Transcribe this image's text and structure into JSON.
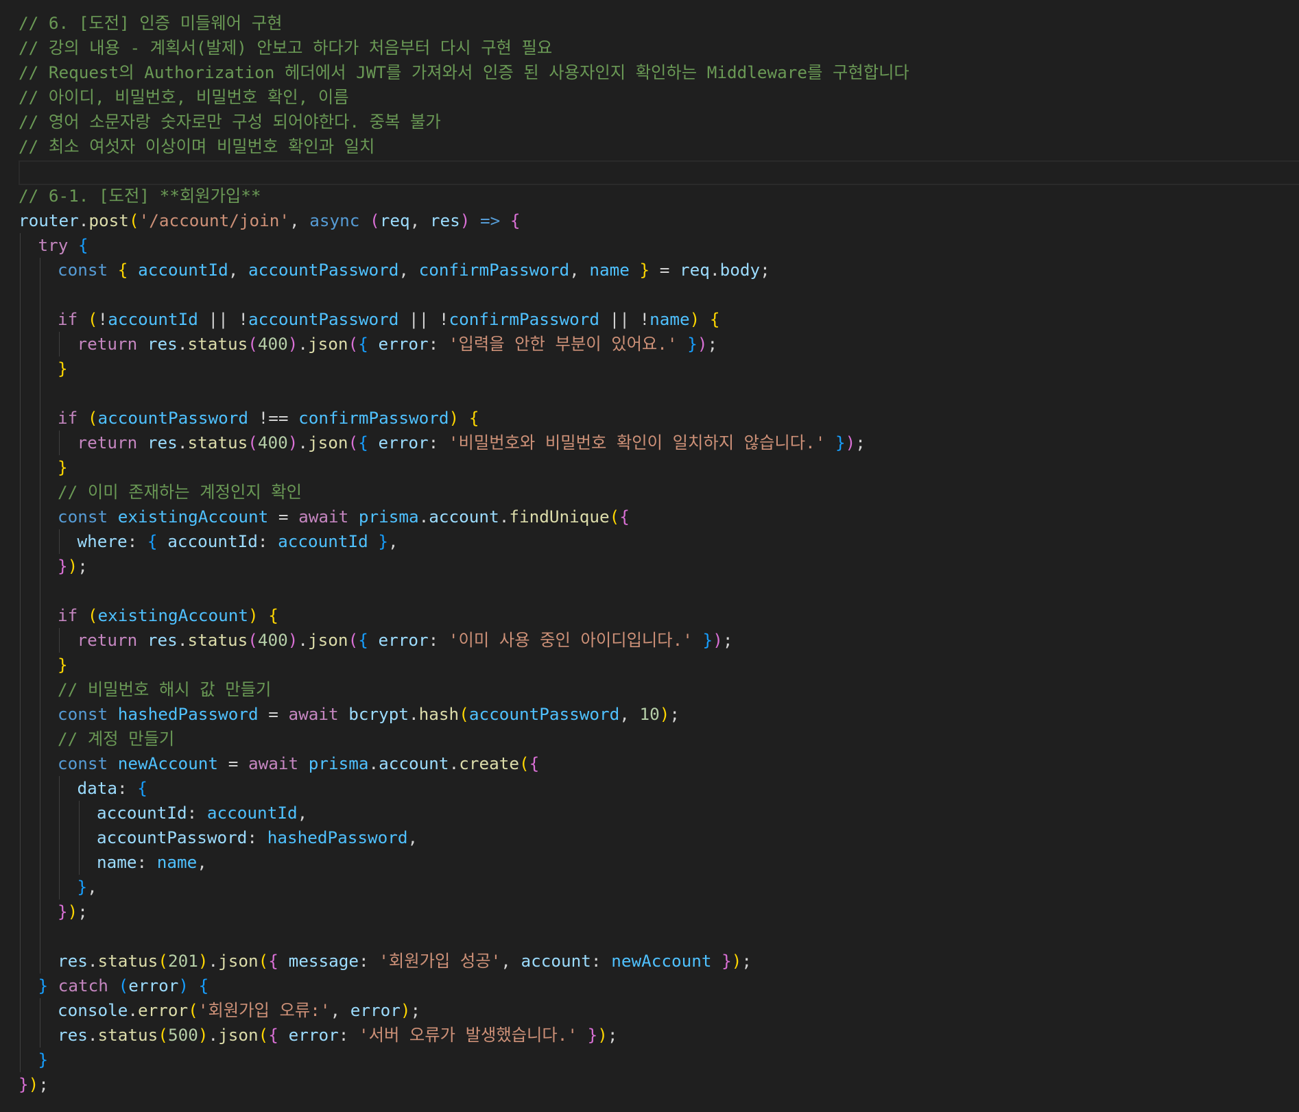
{
  "theme": {
    "background": "#1f1f1f",
    "colors": {
      "cmt": "#6a9955",
      "key": "#c586c0",
      "dec": "#569cd6",
      "var": "#4fc1ff",
      "prop": "#9cdcfe",
      "fn": "#dcdcaa",
      "str": "#ce9178",
      "num": "#b5cea8",
      "p1": "#ffd700",
      "p2": "#da70d6",
      "p3": "#179fff",
      "pl": "#d4d4d4"
    }
  },
  "code": [
    {
      "indent": 0,
      "tokens": [
        [
          "cmt",
          "// 6. [도전] 인증 미들웨어 구현"
        ]
      ]
    },
    {
      "indent": 0,
      "tokens": [
        [
          "cmt",
          "// 강의 내용 - 계획서(발제) 안보고 하다가 처음부터 다시 구현 필요"
        ]
      ]
    },
    {
      "indent": 0,
      "tokens": [
        [
          "cmt",
          "// Request의 Authorization 헤더에서 JWT를 가져와서 인증 된 사용자인지 확인하는 Middleware를 구현합니다"
        ]
      ]
    },
    {
      "indent": 0,
      "tokens": [
        [
          "cmt",
          "// 아이디, 비밀번호, 비밀번호 확인, 이름"
        ]
      ]
    },
    {
      "indent": 0,
      "tokens": [
        [
          "cmt",
          "// 영어 소문자랑 숫자로만 구성 되어야한다. 중복 불가"
        ]
      ]
    },
    {
      "indent": 0,
      "tokens": [
        [
          "cmt",
          "// 최소 여섯자 이상이며 비밀번호 확인과 일치"
        ]
      ]
    },
    {
      "indent": 0,
      "tokens": []
    },
    {
      "indent": 0,
      "tokens": [
        [
          "cmt",
          "// 6-1. [도전] **회원가입**"
        ]
      ]
    },
    {
      "indent": 0,
      "tokens": [
        [
          "prop",
          "router"
        ],
        [
          "pl",
          "."
        ],
        [
          "fn",
          "post"
        ],
        [
          "p1",
          "("
        ],
        [
          "str",
          "'/account/join'"
        ],
        [
          "pl",
          ", "
        ],
        [
          "dec",
          "async"
        ],
        [
          "pl",
          " "
        ],
        [
          "p2",
          "("
        ],
        [
          "prop",
          "req"
        ],
        [
          "pl",
          ", "
        ],
        [
          "prop",
          "res"
        ],
        [
          "p2",
          ")"
        ],
        [
          "pl",
          " "
        ],
        [
          "dec",
          "=>"
        ],
        [
          "pl",
          " "
        ],
        [
          "p2",
          "{"
        ]
      ]
    },
    {
      "indent": 1,
      "tokens": [
        [
          "key",
          "try"
        ],
        [
          "pl",
          " "
        ],
        [
          "p3",
          "{"
        ]
      ]
    },
    {
      "indent": 2,
      "tokens": [
        [
          "dec",
          "const"
        ],
        [
          "pl",
          " "
        ],
        [
          "p1",
          "{"
        ],
        [
          "pl",
          " "
        ],
        [
          "var",
          "accountId"
        ],
        [
          "pl",
          ", "
        ],
        [
          "var",
          "accountPassword"
        ],
        [
          "pl",
          ", "
        ],
        [
          "var",
          "confirmPassword"
        ],
        [
          "pl",
          ", "
        ],
        [
          "var",
          "name"
        ],
        [
          "pl",
          " "
        ],
        [
          "p1",
          "}"
        ],
        [
          "pl",
          " = "
        ],
        [
          "prop",
          "req"
        ],
        [
          "pl",
          "."
        ],
        [
          "prop",
          "body"
        ],
        [
          "pl",
          ";"
        ]
      ]
    },
    {
      "indent": 0,
      "tokens": []
    },
    {
      "indent": 2,
      "tokens": [
        [
          "key",
          "if"
        ],
        [
          "pl",
          " "
        ],
        [
          "p1",
          "("
        ],
        [
          "pl",
          "!"
        ],
        [
          "var",
          "accountId"
        ],
        [
          "pl",
          " || !"
        ],
        [
          "var",
          "accountPassword"
        ],
        [
          "pl",
          " || !"
        ],
        [
          "var",
          "confirmPassword"
        ],
        [
          "pl",
          " || !"
        ],
        [
          "var",
          "name"
        ],
        [
          "p1",
          ")"
        ],
        [
          "pl",
          " "
        ],
        [
          "p1",
          "{"
        ]
      ]
    },
    {
      "indent": 3,
      "tokens": [
        [
          "key",
          "return"
        ],
        [
          "pl",
          " "
        ],
        [
          "prop",
          "res"
        ],
        [
          "pl",
          "."
        ],
        [
          "fn",
          "status"
        ],
        [
          "p2",
          "("
        ],
        [
          "num",
          "400"
        ],
        [
          "p2",
          ")"
        ],
        [
          "pl",
          "."
        ],
        [
          "fn",
          "json"
        ],
        [
          "p2",
          "("
        ],
        [
          "p3",
          "{"
        ],
        [
          "pl",
          " "
        ],
        [
          "prop",
          "error"
        ],
        [
          "pl",
          ": "
        ],
        [
          "str",
          "'입력을 안한 부분이 있어요.'"
        ],
        [
          "pl",
          " "
        ],
        [
          "p3",
          "}"
        ],
        [
          "p2",
          ")"
        ],
        [
          "pl",
          ";"
        ]
      ]
    },
    {
      "indent": 2,
      "tokens": [
        [
          "p1",
          "}"
        ]
      ]
    },
    {
      "indent": 0,
      "tokens": []
    },
    {
      "indent": 2,
      "tokens": [
        [
          "key",
          "if"
        ],
        [
          "pl",
          " "
        ],
        [
          "p1",
          "("
        ],
        [
          "var",
          "accountPassword"
        ],
        [
          "pl",
          " !== "
        ],
        [
          "var",
          "confirmPassword"
        ],
        [
          "p1",
          ")"
        ],
        [
          "pl",
          " "
        ],
        [
          "p1",
          "{"
        ]
      ]
    },
    {
      "indent": 3,
      "tokens": [
        [
          "key",
          "return"
        ],
        [
          "pl",
          " "
        ],
        [
          "prop",
          "res"
        ],
        [
          "pl",
          "."
        ],
        [
          "fn",
          "status"
        ],
        [
          "p2",
          "("
        ],
        [
          "num",
          "400"
        ],
        [
          "p2",
          ")"
        ],
        [
          "pl",
          "."
        ],
        [
          "fn",
          "json"
        ],
        [
          "p2",
          "("
        ],
        [
          "p3",
          "{"
        ],
        [
          "pl",
          " "
        ],
        [
          "prop",
          "error"
        ],
        [
          "pl",
          ": "
        ],
        [
          "str",
          "'비밀번호와 비밀번호 확인이 일치하지 않습니다.'"
        ],
        [
          "pl",
          " "
        ],
        [
          "p3",
          "}"
        ],
        [
          "p2",
          ")"
        ],
        [
          "pl",
          ";"
        ]
      ]
    },
    {
      "indent": 2,
      "tokens": [
        [
          "p1",
          "}"
        ]
      ]
    },
    {
      "indent": 2,
      "tokens": [
        [
          "cmt",
          "// 이미 존재하는 계정인지 확인"
        ]
      ]
    },
    {
      "indent": 2,
      "tokens": [
        [
          "dec",
          "const"
        ],
        [
          "pl",
          " "
        ],
        [
          "var",
          "existingAccount"
        ],
        [
          "pl",
          " = "
        ],
        [
          "key",
          "await"
        ],
        [
          "pl",
          " "
        ],
        [
          "var",
          "prisma"
        ],
        [
          "pl",
          "."
        ],
        [
          "prop",
          "account"
        ],
        [
          "pl",
          "."
        ],
        [
          "fn",
          "findUnique"
        ],
        [
          "p1",
          "("
        ],
        [
          "p2",
          "{"
        ]
      ]
    },
    {
      "indent": 3,
      "tokens": [
        [
          "prop",
          "where"
        ],
        [
          "pl",
          ": "
        ],
        [
          "p3",
          "{"
        ],
        [
          "pl",
          " "
        ],
        [
          "prop",
          "accountId"
        ],
        [
          "pl",
          ": "
        ],
        [
          "var",
          "accountId"
        ],
        [
          "pl",
          " "
        ],
        [
          "p3",
          "}"
        ],
        [
          "pl",
          ","
        ]
      ]
    },
    {
      "indent": 2,
      "tokens": [
        [
          "p2",
          "}"
        ],
        [
          "p1",
          ")"
        ],
        [
          "pl",
          ";"
        ]
      ]
    },
    {
      "indent": 0,
      "tokens": []
    },
    {
      "indent": 2,
      "tokens": [
        [
          "key",
          "if"
        ],
        [
          "pl",
          " "
        ],
        [
          "p1",
          "("
        ],
        [
          "var",
          "existingAccount"
        ],
        [
          "p1",
          ")"
        ],
        [
          "pl",
          " "
        ],
        [
          "p1",
          "{"
        ]
      ]
    },
    {
      "indent": 3,
      "tokens": [
        [
          "key",
          "return"
        ],
        [
          "pl",
          " "
        ],
        [
          "prop",
          "res"
        ],
        [
          "pl",
          "."
        ],
        [
          "fn",
          "status"
        ],
        [
          "p2",
          "("
        ],
        [
          "num",
          "400"
        ],
        [
          "p2",
          ")"
        ],
        [
          "pl",
          "."
        ],
        [
          "fn",
          "json"
        ],
        [
          "p2",
          "("
        ],
        [
          "p3",
          "{"
        ],
        [
          "pl",
          " "
        ],
        [
          "prop",
          "error"
        ],
        [
          "pl",
          ": "
        ],
        [
          "str",
          "'이미 사용 중인 아이디입니다.'"
        ],
        [
          "pl",
          " "
        ],
        [
          "p3",
          "}"
        ],
        [
          "p2",
          ")"
        ],
        [
          "pl",
          ";"
        ]
      ]
    },
    {
      "indent": 2,
      "tokens": [
        [
          "p1",
          "}"
        ]
      ]
    },
    {
      "indent": 2,
      "tokens": [
        [
          "cmt",
          "// 비밀번호 해시 값 만들기"
        ]
      ]
    },
    {
      "indent": 2,
      "tokens": [
        [
          "dec",
          "const"
        ],
        [
          "pl",
          " "
        ],
        [
          "var",
          "hashedPassword"
        ],
        [
          "pl",
          " = "
        ],
        [
          "key",
          "await"
        ],
        [
          "pl",
          " "
        ],
        [
          "prop",
          "bcrypt"
        ],
        [
          "pl",
          "."
        ],
        [
          "fn",
          "hash"
        ],
        [
          "p1",
          "("
        ],
        [
          "var",
          "accountPassword"
        ],
        [
          "pl",
          ", "
        ],
        [
          "num",
          "10"
        ],
        [
          "p1",
          ")"
        ],
        [
          "pl",
          ";"
        ]
      ]
    },
    {
      "indent": 2,
      "tokens": [
        [
          "cmt",
          "// 계정 만들기"
        ]
      ]
    },
    {
      "indent": 2,
      "tokens": [
        [
          "dec",
          "const"
        ],
        [
          "pl",
          " "
        ],
        [
          "var",
          "newAccount"
        ],
        [
          "pl",
          " = "
        ],
        [
          "key",
          "await"
        ],
        [
          "pl",
          " "
        ],
        [
          "var",
          "prisma"
        ],
        [
          "pl",
          "."
        ],
        [
          "prop",
          "account"
        ],
        [
          "pl",
          "."
        ],
        [
          "fn",
          "create"
        ],
        [
          "p1",
          "("
        ],
        [
          "p2",
          "{"
        ]
      ]
    },
    {
      "indent": 3,
      "tokens": [
        [
          "prop",
          "data"
        ],
        [
          "pl",
          ": "
        ],
        [
          "p3",
          "{"
        ]
      ]
    },
    {
      "indent": 4,
      "tokens": [
        [
          "prop",
          "accountId"
        ],
        [
          "pl",
          ": "
        ],
        [
          "var",
          "accountId"
        ],
        [
          "pl",
          ","
        ]
      ]
    },
    {
      "indent": 4,
      "tokens": [
        [
          "prop",
          "accountPassword"
        ],
        [
          "pl",
          ": "
        ],
        [
          "var",
          "hashedPassword"
        ],
        [
          "pl",
          ","
        ]
      ]
    },
    {
      "indent": 4,
      "tokens": [
        [
          "prop",
          "name"
        ],
        [
          "pl",
          ": "
        ],
        [
          "var",
          "name"
        ],
        [
          "pl",
          ","
        ]
      ]
    },
    {
      "indent": 3,
      "tokens": [
        [
          "p3",
          "}"
        ],
        [
          "pl",
          ","
        ]
      ]
    },
    {
      "indent": 2,
      "tokens": [
        [
          "p2",
          "}"
        ],
        [
          "p1",
          ")"
        ],
        [
          "pl",
          ";"
        ]
      ]
    },
    {
      "indent": 0,
      "tokens": []
    },
    {
      "indent": 2,
      "tokens": [
        [
          "prop",
          "res"
        ],
        [
          "pl",
          "."
        ],
        [
          "fn",
          "status"
        ],
        [
          "p1",
          "("
        ],
        [
          "num",
          "201"
        ],
        [
          "p1",
          ")"
        ],
        [
          "pl",
          "."
        ],
        [
          "fn",
          "json"
        ],
        [
          "p1",
          "("
        ],
        [
          "p2",
          "{"
        ],
        [
          "pl",
          " "
        ],
        [
          "prop",
          "message"
        ],
        [
          "pl",
          ": "
        ],
        [
          "str",
          "'회원가입 성공'"
        ],
        [
          "pl",
          ", "
        ],
        [
          "prop",
          "account"
        ],
        [
          "pl",
          ": "
        ],
        [
          "var",
          "newAccount"
        ],
        [
          "pl",
          " "
        ],
        [
          "p2",
          "}"
        ],
        [
          "p1",
          ")"
        ],
        [
          "pl",
          ";"
        ]
      ]
    },
    {
      "indent": 1,
      "tokens": [
        [
          "p3",
          "}"
        ],
        [
          "pl",
          " "
        ],
        [
          "key",
          "catch"
        ],
        [
          "pl",
          " "
        ],
        [
          "p3",
          "("
        ],
        [
          "prop",
          "error"
        ],
        [
          "p3",
          ")"
        ],
        [
          "pl",
          " "
        ],
        [
          "p3",
          "{"
        ]
      ]
    },
    {
      "indent": 2,
      "tokens": [
        [
          "prop",
          "console"
        ],
        [
          "pl",
          "."
        ],
        [
          "fn",
          "error"
        ],
        [
          "p1",
          "("
        ],
        [
          "str",
          "'회원가입 오류:'"
        ],
        [
          "pl",
          ", "
        ],
        [
          "prop",
          "error"
        ],
        [
          "p1",
          ")"
        ],
        [
          "pl",
          ";"
        ]
      ]
    },
    {
      "indent": 2,
      "tokens": [
        [
          "prop",
          "res"
        ],
        [
          "pl",
          "."
        ],
        [
          "fn",
          "status"
        ],
        [
          "p1",
          "("
        ],
        [
          "num",
          "500"
        ],
        [
          "p1",
          ")"
        ],
        [
          "pl",
          "."
        ],
        [
          "fn",
          "json"
        ],
        [
          "p1",
          "("
        ],
        [
          "p2",
          "{"
        ],
        [
          "pl",
          " "
        ],
        [
          "prop",
          "error"
        ],
        [
          "pl",
          ": "
        ],
        [
          "str",
          "'서버 오류가 발생했습니다.'"
        ],
        [
          "pl",
          " "
        ],
        [
          "p2",
          "}"
        ],
        [
          "p1",
          ")"
        ],
        [
          "pl",
          ";"
        ]
      ]
    },
    {
      "indent": 1,
      "tokens": [
        [
          "p3",
          "}"
        ]
      ]
    },
    {
      "indent": 0,
      "tokens": [
        [
          "p2",
          "}"
        ],
        [
          "p1",
          ")"
        ],
        [
          "pl",
          ";"
        ]
      ]
    }
  ]
}
